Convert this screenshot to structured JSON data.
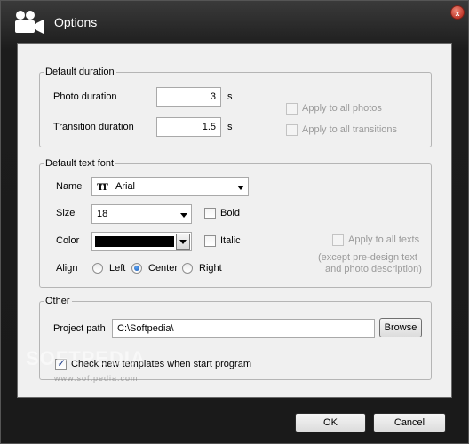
{
  "window": {
    "title": "Options",
    "close_glyph": "x"
  },
  "default_duration": {
    "legend": "Default duration",
    "photo_label": "Photo duration",
    "photo_value": "3",
    "photo_unit": "s",
    "transition_label": "Transition duration",
    "transition_value": "1.5",
    "transition_unit": "s",
    "apply_photos_label": "Apply to all photos",
    "apply_transitions_label": "Apply to all transitions"
  },
  "default_text_font": {
    "legend": "Default text font",
    "name_label": "Name",
    "font_icon_glyph": "TT",
    "font_value": "Arial",
    "size_label": "Size",
    "size_value": "18",
    "bold_label": "Bold",
    "color_label": "Color",
    "color_value_hex": "#000000",
    "italic_label": "Italic",
    "align_label": "Align",
    "align_options": [
      "Left",
      "Center",
      "Right"
    ],
    "align_selected": "Center",
    "apply_texts_label": "Apply to all texts",
    "apply_texts_note_line1": "(except pre-design text",
    "apply_texts_note_line2": "and photo description)"
  },
  "other": {
    "legend": "Other",
    "project_path_label": "Project path",
    "project_path_value": "C:\\Softpedia\\",
    "browse_label": "Browse",
    "check_templates_label": "Check new templates when start program",
    "check_templates_checked": true
  },
  "footer": {
    "ok_label": "OK",
    "cancel_label": "Cancel"
  },
  "watermark": {
    "text": "SOFTPEDIA",
    "url": "www.softpedia.com"
  },
  "colors": {
    "frame": "#1c1c1c",
    "panel": "#f0f0f0",
    "close": "#c0392b",
    "radio_on": "#1c5cb4"
  },
  "icons": {
    "app": "video-camera-icon",
    "close": "close-icon",
    "font": "truetype-font-icon"
  }
}
